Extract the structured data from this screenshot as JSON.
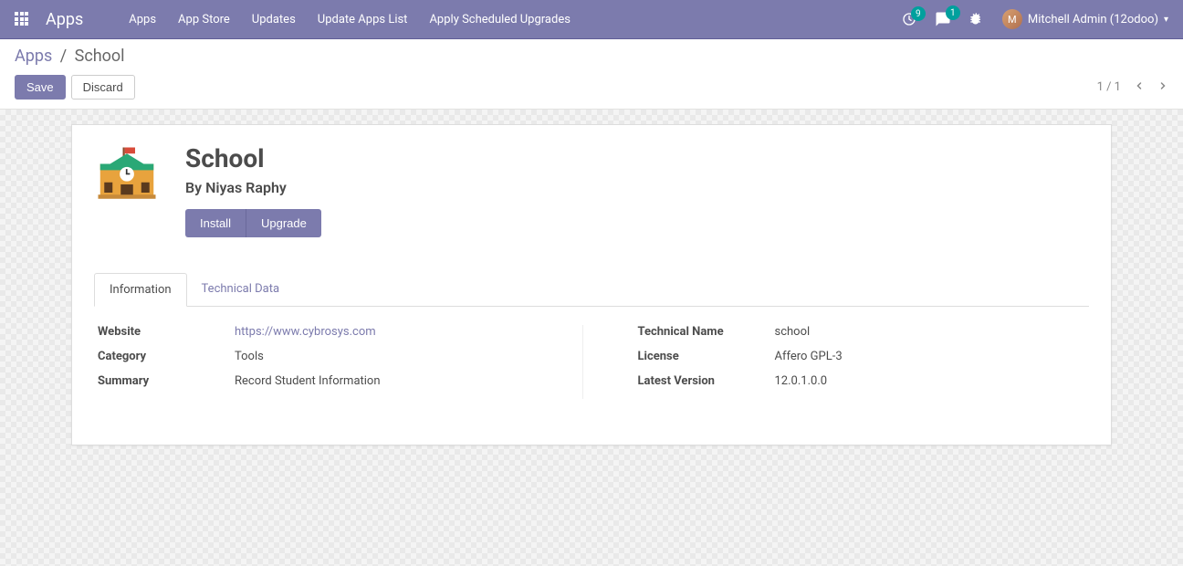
{
  "navbar": {
    "brand": "Apps",
    "menu": [
      "Apps",
      "App Store",
      "Updates",
      "Update Apps List",
      "Apply Scheduled Upgrades"
    ],
    "activity_count": "9",
    "message_count": "1",
    "user_name": "Mitchell Admin (12odoo)"
  },
  "breadcrumb": {
    "root": "Apps",
    "current": "School"
  },
  "control": {
    "save": "Save",
    "discard": "Discard",
    "pager": "1 / 1"
  },
  "record": {
    "title": "School",
    "author_prefix": "By ",
    "author": "Niyas Raphy",
    "install": "Install",
    "upgrade": "Upgrade"
  },
  "tabs": {
    "info": "Information",
    "tech": "Technical Data"
  },
  "fields": {
    "website_label": "Website",
    "website_value": "https://www.cybrosys.com",
    "category_label": "Category",
    "category_value": "Tools",
    "summary_label": "Summary",
    "summary_value": "Record Student Information",
    "technical_name_label": "Technical Name",
    "technical_name_value": "school",
    "license_label": "License",
    "license_value": "Affero GPL-3",
    "latest_version_label": "Latest Version",
    "latest_version_value": "12.0.1.0.0"
  }
}
